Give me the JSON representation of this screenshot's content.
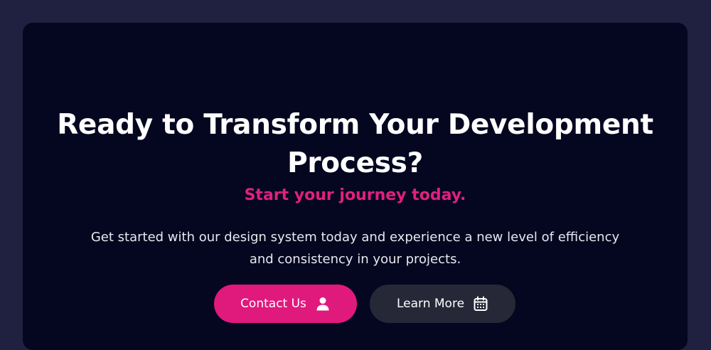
{
  "cta": {
    "headline_line1": "Ready to Transform Your Development",
    "headline_line2": "Process?",
    "tagline": "Start your journey today.",
    "description_line1": "Get started with our design system today and experience a new level of efficiency",
    "description_line2": "and consistency in your projects.",
    "primary_button": {
      "label": "Contact Us",
      "icon": "user-icon"
    },
    "secondary_button": {
      "label": "Learn More",
      "icon": "calendar-icon"
    }
  },
  "colors": {
    "page_background": "#202040",
    "card_background": "#050720",
    "accent": "#e0197d",
    "secondary_button": "#262838",
    "text": "#ffffff"
  }
}
